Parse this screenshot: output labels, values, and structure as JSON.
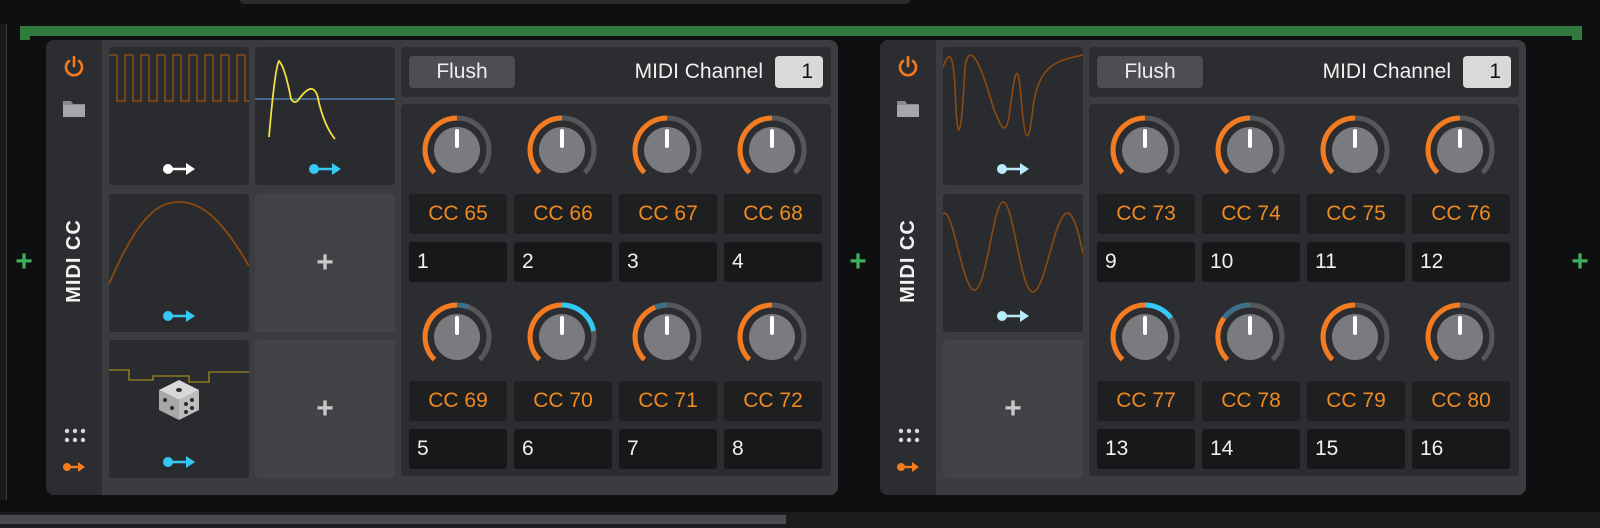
{
  "colors": {
    "accent": "#f47b20",
    "blue": "#36c8f4",
    "green": "#3fae5a",
    "knob": "#7a7b7e"
  },
  "add_plus": "+",
  "devices": [
    {
      "title": "MIDI CC",
      "flush_label": "Flush",
      "channel_label": "MIDI Channel",
      "channel_value": "1",
      "cc_labels": [
        "CC 65",
        "CC 66",
        "CC 67",
        "CC 68",
        "CC 69",
        "CC 70",
        "CC 71",
        "CC 72"
      ],
      "slot_numbers": [
        "1",
        "2",
        "3",
        "4",
        "5",
        "6",
        "7",
        "8"
      ]
    },
    {
      "title": "MIDI CC",
      "flush_label": "Flush",
      "channel_label": "MIDI Channel",
      "channel_value": "1",
      "cc_labels": [
        "CC 73",
        "CC 74",
        "CC 75",
        "CC 76",
        "CC 77",
        "CC 78",
        "CC 79",
        "CC 80"
      ],
      "slot_numbers": [
        "9",
        "10",
        "11",
        "12",
        "13",
        "14",
        "15",
        "16"
      ]
    }
  ]
}
